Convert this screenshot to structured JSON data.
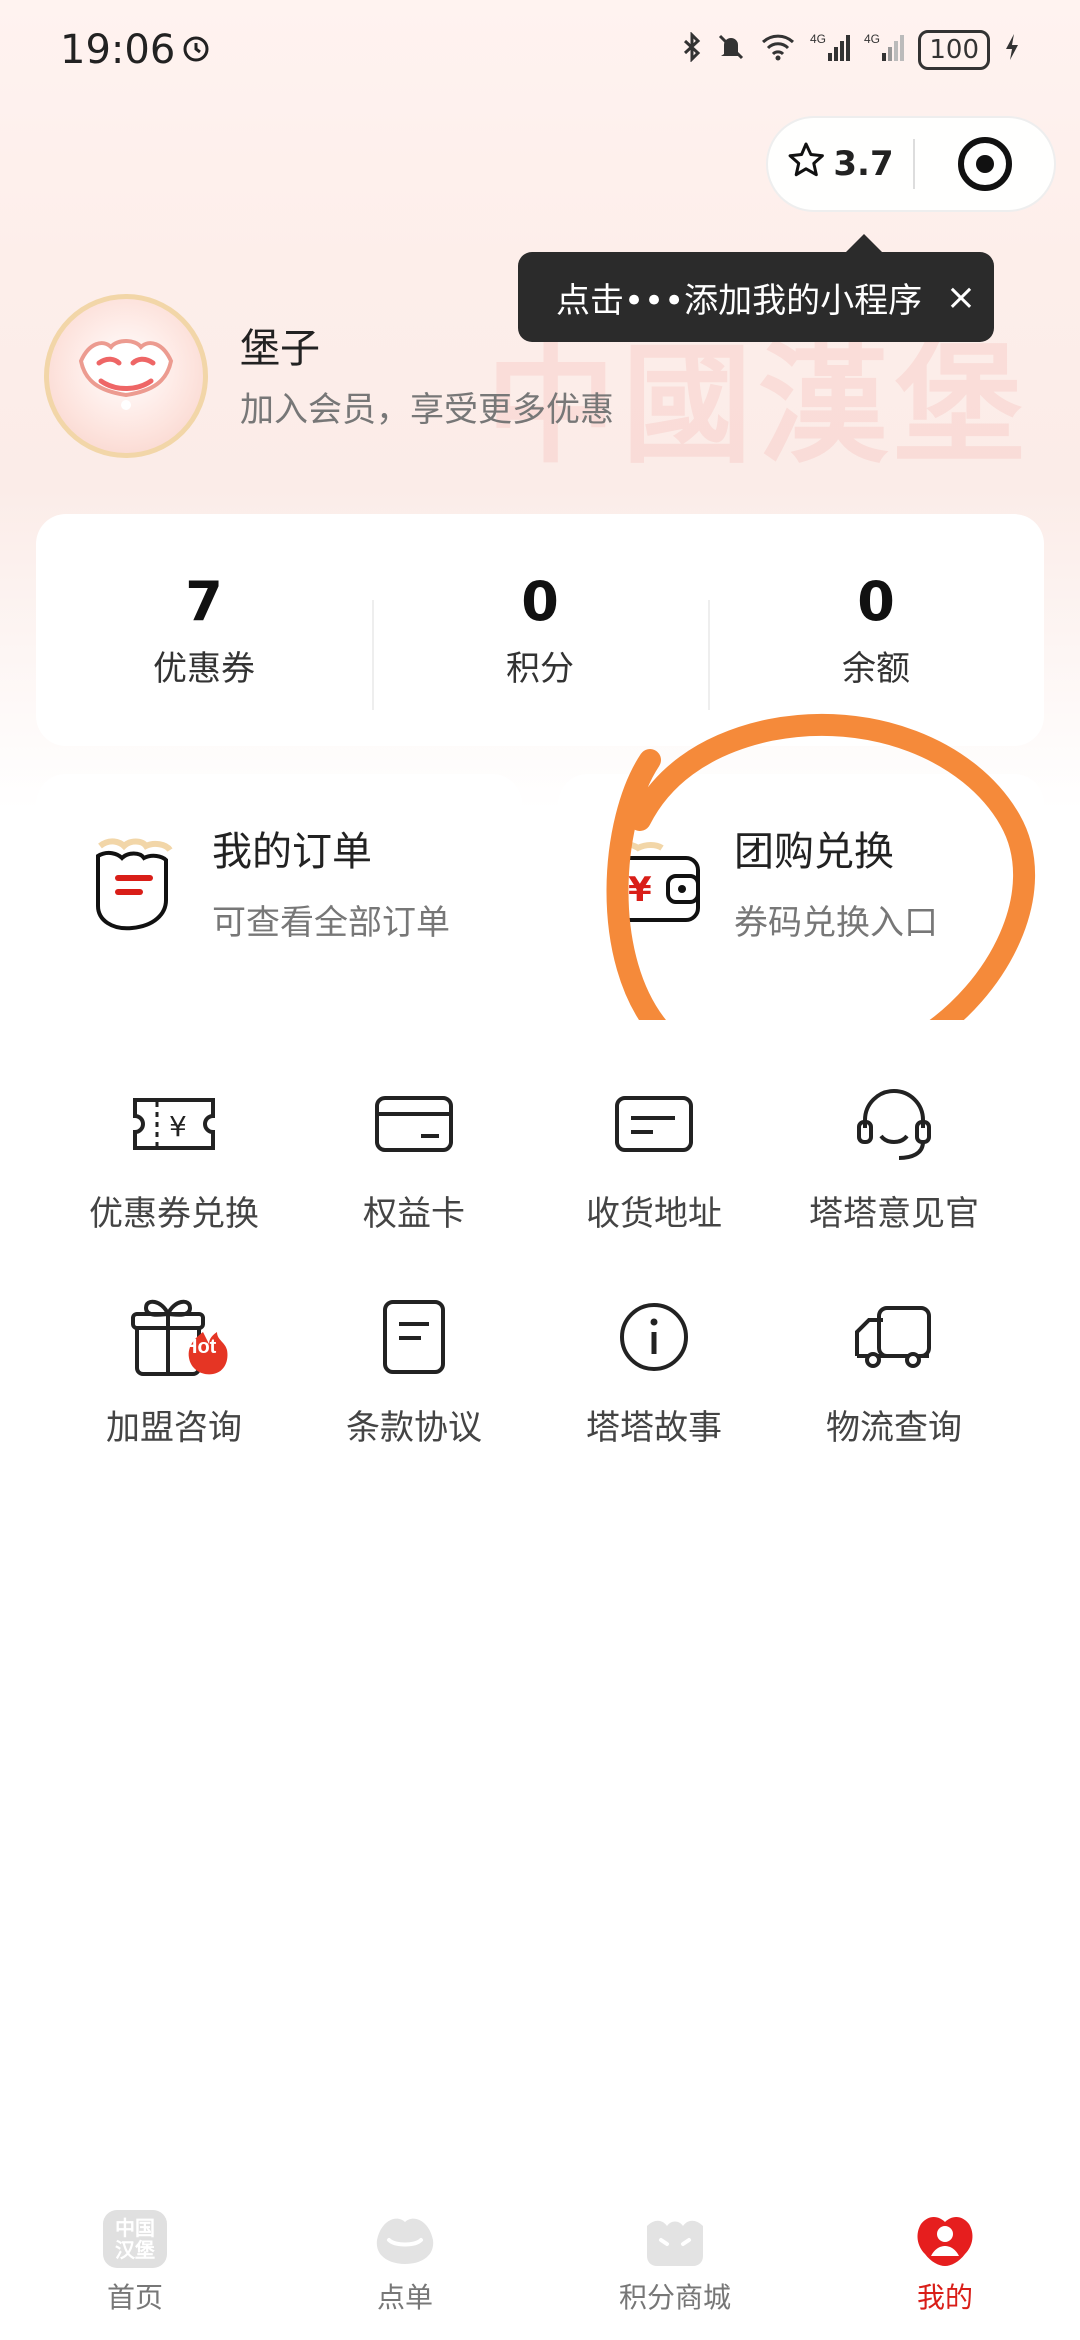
{
  "status_bar": {
    "time": "19:06",
    "battery": "100",
    "icons": [
      "alarm-icon",
      "bluetooth-icon",
      "mute-icon",
      "wifi-icon",
      "signal-4g-icon",
      "signal-4g-icon",
      "charging-icon"
    ]
  },
  "capsule": {
    "rating": "3.7",
    "icons": [
      "star-icon",
      "target-icon"
    ]
  },
  "tooltip": {
    "text": "点击•••添加我的小程序",
    "close": "×"
  },
  "profile": {
    "username": "堡子",
    "member_tip": "加入会员，享受更多优惠"
  },
  "stats": [
    {
      "value": "7",
      "label": "优惠券"
    },
    {
      "value": "0",
      "label": "积分"
    },
    {
      "value": "0",
      "label": "余额"
    }
  ],
  "shortcuts": [
    {
      "title": "我的订单",
      "subtitle": "可查看全部订单",
      "icon": "order-bag-icon"
    },
    {
      "title": "团购兑换",
      "subtitle": "券码兑换入口",
      "icon": "wallet-yen-icon"
    }
  ],
  "tools": [
    {
      "label": "优惠券兑换",
      "icon": "coupon-icon"
    },
    {
      "label": "权益卡",
      "icon": "card-icon"
    },
    {
      "label": "收货地址",
      "icon": "address-icon"
    },
    {
      "label": "塔塔意见官",
      "icon": "headset-icon"
    },
    {
      "label": "加盟咨询",
      "icon": "gift-hot-icon",
      "badge": "Hot"
    },
    {
      "label": "条款协议",
      "icon": "document-icon"
    },
    {
      "label": "塔塔故事",
      "icon": "info-icon"
    },
    {
      "label": "物流查询",
      "icon": "truck-icon"
    }
  ],
  "bottom_nav": [
    {
      "label": "首页",
      "icon": "home-logo-icon",
      "icon_text": "中国\n汉堡"
    },
    {
      "label": "点单",
      "icon": "order-mascot-icon"
    },
    {
      "label": "积分商城",
      "icon": "mall-mascot-icon"
    },
    {
      "label": "我的",
      "icon": "profile-mascot-icon",
      "active": true
    }
  ],
  "colors": {
    "accent": "#d91e18",
    "annotation": "#f58a3a"
  }
}
